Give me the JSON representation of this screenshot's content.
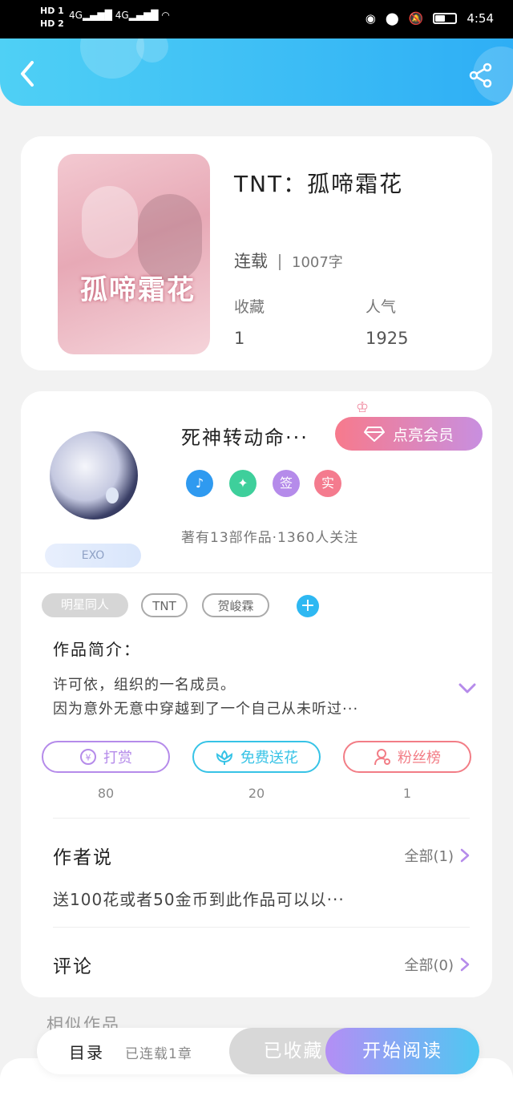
{
  "status_bar": {
    "hd1": "HD 1",
    "hd2": "HD 2",
    "signal1": "4G",
    "signal2": "4G",
    "time": "4:54"
  },
  "header": {
    "back_icon": "chevron-left-icon",
    "share_icon": "share-icon"
  },
  "book": {
    "cover_text": "孤啼霜花",
    "title": "TNT：孤啼霜花",
    "status": "连载",
    "word_count": "1007字",
    "favorites_label": "收藏",
    "favorites_value": "1",
    "popularity_label": "人气",
    "popularity_value": "1925"
  },
  "author": {
    "name": "死神转动命···",
    "vip_button": "点亮会员",
    "tag": "EXO",
    "badges": [
      {
        "icon": "music-note-icon",
        "color": "#2f9af0"
      },
      {
        "icon": "handshake-icon",
        "color": "#3ecf9b"
      },
      {
        "label": "签",
        "color": "#b58bea"
      },
      {
        "label": "实",
        "color": "#f47b8e"
      }
    ],
    "info": "著有13部作品·1360人关注"
  },
  "tags": [
    "明星同人",
    "TNT",
    "贺峻霖"
  ],
  "intro": {
    "title": "作品简介：",
    "line1": "许可依，组织的一名成员。",
    "line2": "因为意外无意中穿越到了一个自己从未听过···"
  },
  "actions": [
    {
      "label": "打赏",
      "count": "80",
      "icon": "yen-coin-icon",
      "color": "#b58bea"
    },
    {
      "label": "免费送花",
      "count": "20",
      "icon": "flower-icon",
      "color": "#37c3e6"
    },
    {
      "label": "粉丝榜",
      "count": "1",
      "icon": "user-icon",
      "color": "#f27d86"
    }
  ],
  "author_says": {
    "title": "作者说",
    "all": "全部(1)",
    "text": "送100花或者50金币到此作品可以以···"
  },
  "comments": {
    "title": "评论",
    "all": "全部(0)"
  },
  "similar_title": "相似作品",
  "bottom_bar": {
    "toc": "目录",
    "toc_sub": "已连载1章",
    "collected": "已收藏",
    "read": "开始阅读"
  },
  "colors": {
    "header_start": "#4fd0f5",
    "header_end": "#2eaef5",
    "accent_purple": "#b58bea",
    "accent_blue": "#2eb8f2"
  }
}
